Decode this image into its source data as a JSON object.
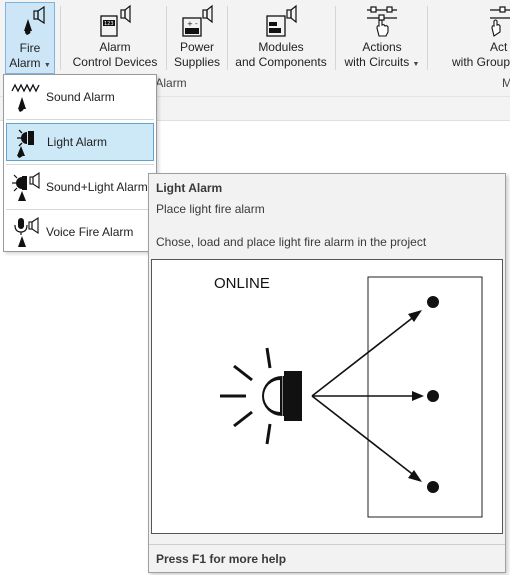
{
  "ribbon": {
    "buttons": [
      {
        "label1": "Fire",
        "label2": "Alarm",
        "icon": "fire-alarm-icon"
      },
      {
        "label1": "Alarm",
        "label2": "Control Devices",
        "icon": "alarm-control-devices-icon"
      },
      {
        "label1": "Power",
        "label2": "Supplies",
        "icon": "power-supplies-icon"
      },
      {
        "label1": "Modules",
        "label2": "and Components",
        "icon": "modules-components-icon"
      },
      {
        "label1": "Actions",
        "label2": "with Circuits",
        "icon": "actions-circuits-icon"
      },
      {
        "label1": "Act",
        "label2": "with Group",
        "icon": "actions-groups-icon"
      }
    ],
    "group_label": "e Alarm",
    "group_label_right": "M"
  },
  "menu": {
    "items": [
      {
        "label": "Sound Alarm",
        "icon": "sound-alarm-icon"
      },
      {
        "label": "Light Alarm",
        "icon": "light-alarm-icon"
      },
      {
        "label": "Sound+Light Alarm",
        "icon": "sound-light-alarm-icon"
      },
      {
        "label": "Voice Fire Alarm",
        "icon": "voice-fire-alarm-icon"
      }
    ],
    "selected_index": 1
  },
  "tooltip": {
    "title": "Light Alarm",
    "subtitle": "Place light fire alarm",
    "description": "Chose, load and place light fire alarm in the project",
    "image_label": "ONLINE",
    "footer": "Press F1 for more help"
  },
  "colors": {
    "selection_bg": "#cde8f7",
    "selection_border": "#5fa3d1"
  }
}
